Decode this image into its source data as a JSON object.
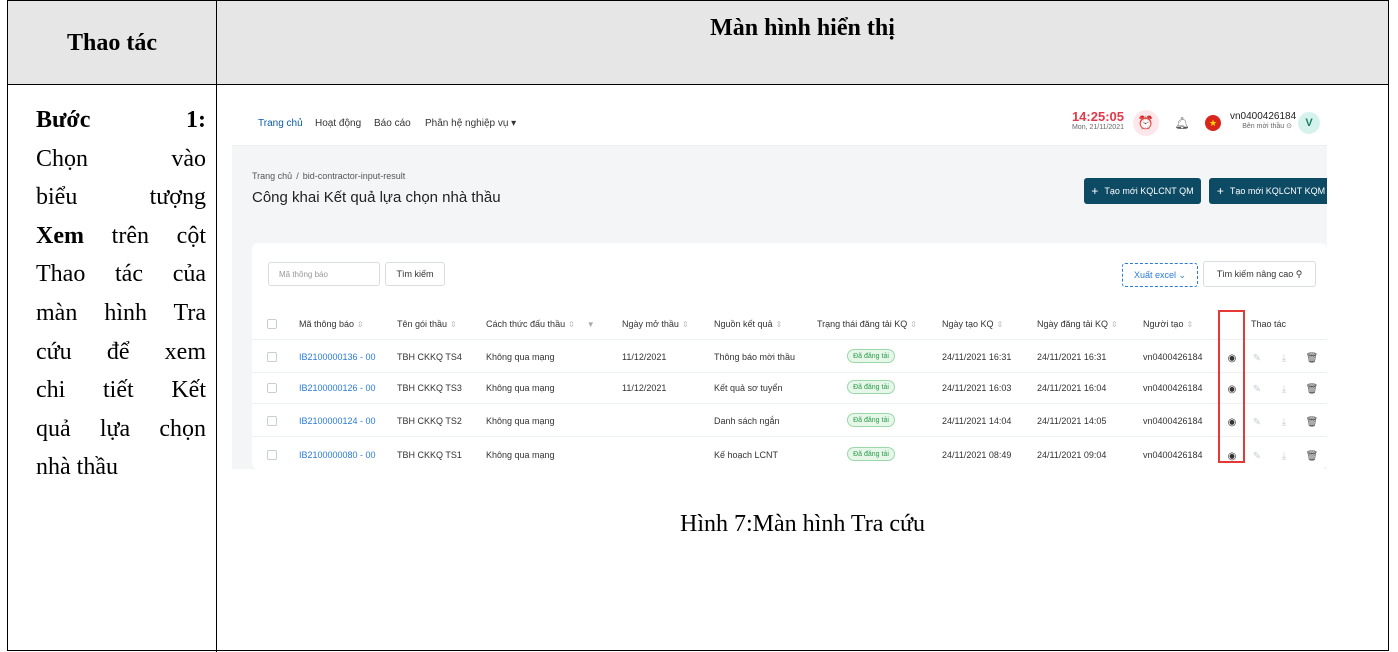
{
  "doc": {
    "header_left": "Thao tác",
    "header_right": "Màn hình hiển thị",
    "step_label": "Bước 1:",
    "step_lines": [
      "Chọn vào",
      "biểu tượng",
      "trên cột",
      "Thao tác của",
      "màn hình Tra",
      "cứu để xem",
      "chi tiết Kết",
      "quả lựa chọn",
      "nhà thầu"
    ],
    "step_bold": "Xem",
    "caption": "Hình 7:Màn hình Tra cứu"
  },
  "app": {
    "nav": [
      "Trang chủ",
      "Hoạt động",
      "Báo cáo",
      "Phân hệ nghiệp vụ ▾"
    ],
    "clock_time": "14:25:05",
    "clock_date": "Mon, 21/11/2021",
    "user_name": "vn0400426184",
    "user_role": "Bên mời thầu ⊙",
    "avatar": "V",
    "breadcrumb": [
      "Trang chủ",
      "/",
      "bid-contractor-input-result"
    ],
    "page_title": "Công khai Kết quả lựa chọn nhà thầu",
    "btn_new_qm": "Tạo mới KQLCNT QM",
    "btn_new_kqm": "Tạo mới KQLCNT KQM",
    "search_placeholder": "Mã thông báo",
    "search_button": "Tìm kiếm",
    "excel_button": "Xuất excel ⌄",
    "advanced_search": "Tìm kiếm nâng cao ⚲",
    "columns": [
      "Mã thông báo",
      "Tên gói thầu",
      "Cách thức đấu thầu",
      "Ngày mở thầu",
      "Nguồn kết quả",
      "Trạng thái đăng tải KQ",
      "Ngày tạo KQ",
      "Ngày đăng tải KQ",
      "Người tạo",
      "Thao tác"
    ],
    "rows": [
      {
        "code": "IB2100000136 - 00",
        "name": "TBH CKKQ TS4",
        "method": "Không qua mạng",
        "open_date": "11/12/2021",
        "source": "Thông báo mời thầu",
        "status": "Đã đăng tải",
        "created": "24/11/2021 16:31",
        "published": "24/11/2021 16:31",
        "creator": "vn0400426184"
      },
      {
        "code": "IB2100000126 - 00",
        "name": "TBH CKKQ TS3",
        "method": "Không qua mạng",
        "open_date": "11/12/2021",
        "source": "Kết quả sơ tuyển",
        "status": "Đã đăng tải",
        "created": "24/11/2021 16:03",
        "published": "24/11/2021 16:04",
        "creator": "vn0400426184"
      },
      {
        "code": "IB2100000124 - 00",
        "name": "TBH CKKQ TS2",
        "method": "Không qua mạng",
        "open_date": "",
        "source": "Danh sách ngắn",
        "status": "Đã đăng tải",
        "created": "24/11/2021 14:04",
        "published": "24/11/2021 14:05",
        "creator": "vn0400426184"
      },
      {
        "code": "IB2100000080 - 00",
        "name": "TBH CKKQ TS1",
        "method": "Không qua mạng",
        "open_date": "",
        "source": "Kế hoạch LCNT",
        "status": "Đã đăng tải",
        "created": "24/11/2021 08:49",
        "published": "24/11/2021 09:04",
        "creator": "vn0400426184"
      }
    ],
    "highlight_color": "#e53935"
  }
}
